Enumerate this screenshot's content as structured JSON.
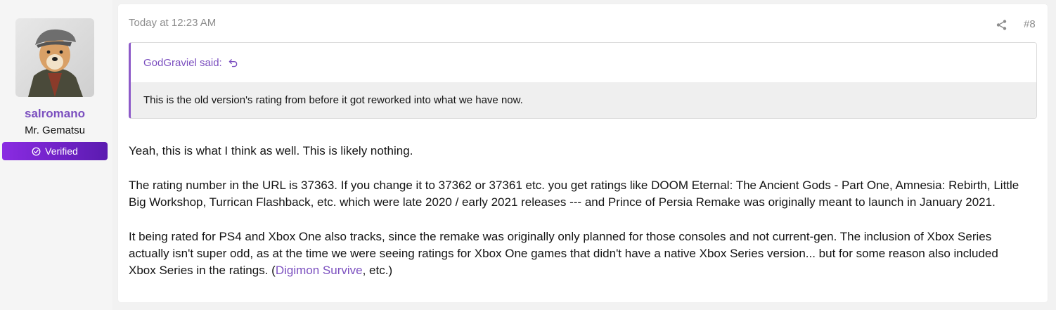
{
  "user": {
    "name": "salromano",
    "title": "Mr. Gematsu",
    "badge": "Verified",
    "avatar_icon": "dog-in-cap-avatar",
    "name_color": "#7b4fbf",
    "badge_colors": [
      "#8a2be2",
      "#5b1bb0"
    ]
  },
  "post": {
    "time": "Today at 12:23 AM",
    "number": "#8",
    "share_icon": "share-icon",
    "quote": {
      "author": "GodGraviel said:",
      "text": "This is the old version's rating from before it got reworked into what we have now.",
      "jump_icon": "reply-arrow-icon"
    },
    "paragraphs": {
      "p1": "Yeah, this is what I think as well. This is likely nothing.",
      "p2_line1": "The rating number in the URL is 37363. If you change it to 37362 or 37361 etc. you get ratings like DOOM Eternal: The Ancient Gods - Part One, Amnesia: Rebirth, Little",
      "p2_line2": "Big Workshop, Turrican Flashback, etc. which were late 2020 / early 2021 releases --- and Prince of Persia Remake was originally meant to launch in January 2021.",
      "p3_line1": "It being rated for PS4 and Xbox One also tracks, since the remake was originally only planned for those consoles and not current-gen. The inclusion of Xbox Series",
      "p3_line2": "actually isn't super odd, as at the time we were seeing ratings for Xbox One games that didn't have a native Xbox Series version... but for some reason also included",
      "p3_line3_pre": "Xbox Series in the ratings. (",
      "p3_link": "Digimon Survive",
      "p3_line3_post": ", etc.)"
    }
  }
}
